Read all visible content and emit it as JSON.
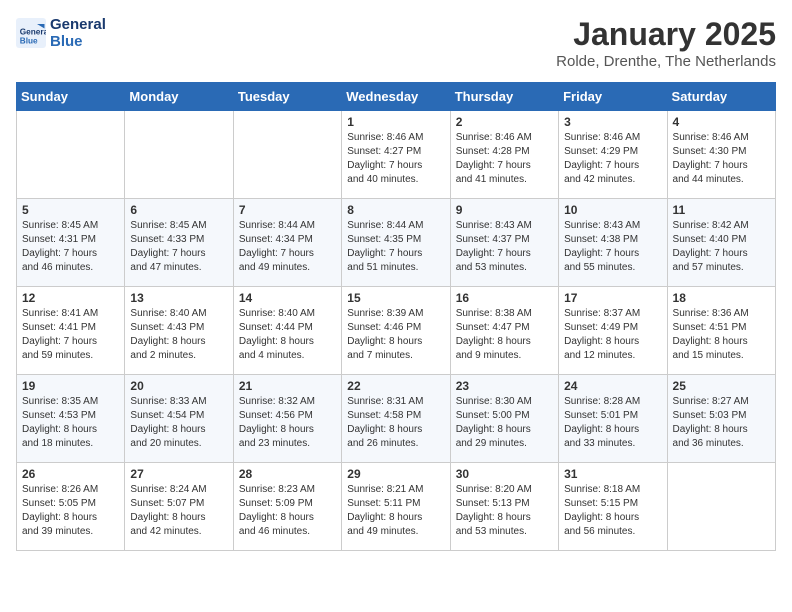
{
  "logo": {
    "line1": "General",
    "line2": "Blue"
  },
  "title": "January 2025",
  "subtitle": "Rolde, Drenthe, The Netherlands",
  "weekdays": [
    "Sunday",
    "Monday",
    "Tuesday",
    "Wednesday",
    "Thursday",
    "Friday",
    "Saturday"
  ],
  "weeks": [
    [
      {
        "day": "",
        "text": ""
      },
      {
        "day": "",
        "text": ""
      },
      {
        "day": "",
        "text": ""
      },
      {
        "day": "1",
        "text": "Sunrise: 8:46 AM\nSunset: 4:27 PM\nDaylight: 7 hours\nand 40 minutes."
      },
      {
        "day": "2",
        "text": "Sunrise: 8:46 AM\nSunset: 4:28 PM\nDaylight: 7 hours\nand 41 minutes."
      },
      {
        "day": "3",
        "text": "Sunrise: 8:46 AM\nSunset: 4:29 PM\nDaylight: 7 hours\nand 42 minutes."
      },
      {
        "day": "4",
        "text": "Sunrise: 8:46 AM\nSunset: 4:30 PM\nDaylight: 7 hours\nand 44 minutes."
      }
    ],
    [
      {
        "day": "5",
        "text": "Sunrise: 8:45 AM\nSunset: 4:31 PM\nDaylight: 7 hours\nand 46 minutes."
      },
      {
        "day": "6",
        "text": "Sunrise: 8:45 AM\nSunset: 4:33 PM\nDaylight: 7 hours\nand 47 minutes."
      },
      {
        "day": "7",
        "text": "Sunrise: 8:44 AM\nSunset: 4:34 PM\nDaylight: 7 hours\nand 49 minutes."
      },
      {
        "day": "8",
        "text": "Sunrise: 8:44 AM\nSunset: 4:35 PM\nDaylight: 7 hours\nand 51 minutes."
      },
      {
        "day": "9",
        "text": "Sunrise: 8:43 AM\nSunset: 4:37 PM\nDaylight: 7 hours\nand 53 minutes."
      },
      {
        "day": "10",
        "text": "Sunrise: 8:43 AM\nSunset: 4:38 PM\nDaylight: 7 hours\nand 55 minutes."
      },
      {
        "day": "11",
        "text": "Sunrise: 8:42 AM\nSunset: 4:40 PM\nDaylight: 7 hours\nand 57 minutes."
      }
    ],
    [
      {
        "day": "12",
        "text": "Sunrise: 8:41 AM\nSunset: 4:41 PM\nDaylight: 7 hours\nand 59 minutes."
      },
      {
        "day": "13",
        "text": "Sunrise: 8:40 AM\nSunset: 4:43 PM\nDaylight: 8 hours\nand 2 minutes."
      },
      {
        "day": "14",
        "text": "Sunrise: 8:40 AM\nSunset: 4:44 PM\nDaylight: 8 hours\nand 4 minutes."
      },
      {
        "day": "15",
        "text": "Sunrise: 8:39 AM\nSunset: 4:46 PM\nDaylight: 8 hours\nand 7 minutes."
      },
      {
        "day": "16",
        "text": "Sunrise: 8:38 AM\nSunset: 4:47 PM\nDaylight: 8 hours\nand 9 minutes."
      },
      {
        "day": "17",
        "text": "Sunrise: 8:37 AM\nSunset: 4:49 PM\nDaylight: 8 hours\nand 12 minutes."
      },
      {
        "day": "18",
        "text": "Sunrise: 8:36 AM\nSunset: 4:51 PM\nDaylight: 8 hours\nand 15 minutes."
      }
    ],
    [
      {
        "day": "19",
        "text": "Sunrise: 8:35 AM\nSunset: 4:53 PM\nDaylight: 8 hours\nand 18 minutes."
      },
      {
        "day": "20",
        "text": "Sunrise: 8:33 AM\nSunset: 4:54 PM\nDaylight: 8 hours\nand 20 minutes."
      },
      {
        "day": "21",
        "text": "Sunrise: 8:32 AM\nSunset: 4:56 PM\nDaylight: 8 hours\nand 23 minutes."
      },
      {
        "day": "22",
        "text": "Sunrise: 8:31 AM\nSunset: 4:58 PM\nDaylight: 8 hours\nand 26 minutes."
      },
      {
        "day": "23",
        "text": "Sunrise: 8:30 AM\nSunset: 5:00 PM\nDaylight: 8 hours\nand 29 minutes."
      },
      {
        "day": "24",
        "text": "Sunrise: 8:28 AM\nSunset: 5:01 PM\nDaylight: 8 hours\nand 33 minutes."
      },
      {
        "day": "25",
        "text": "Sunrise: 8:27 AM\nSunset: 5:03 PM\nDaylight: 8 hours\nand 36 minutes."
      }
    ],
    [
      {
        "day": "26",
        "text": "Sunrise: 8:26 AM\nSunset: 5:05 PM\nDaylight: 8 hours\nand 39 minutes."
      },
      {
        "day": "27",
        "text": "Sunrise: 8:24 AM\nSunset: 5:07 PM\nDaylight: 8 hours\nand 42 minutes."
      },
      {
        "day": "28",
        "text": "Sunrise: 8:23 AM\nSunset: 5:09 PM\nDaylight: 8 hours\nand 46 minutes."
      },
      {
        "day": "29",
        "text": "Sunrise: 8:21 AM\nSunset: 5:11 PM\nDaylight: 8 hours\nand 49 minutes."
      },
      {
        "day": "30",
        "text": "Sunrise: 8:20 AM\nSunset: 5:13 PM\nDaylight: 8 hours\nand 53 minutes."
      },
      {
        "day": "31",
        "text": "Sunrise: 8:18 AM\nSunset: 5:15 PM\nDaylight: 8 hours\nand 56 minutes."
      },
      {
        "day": "",
        "text": ""
      }
    ]
  ]
}
